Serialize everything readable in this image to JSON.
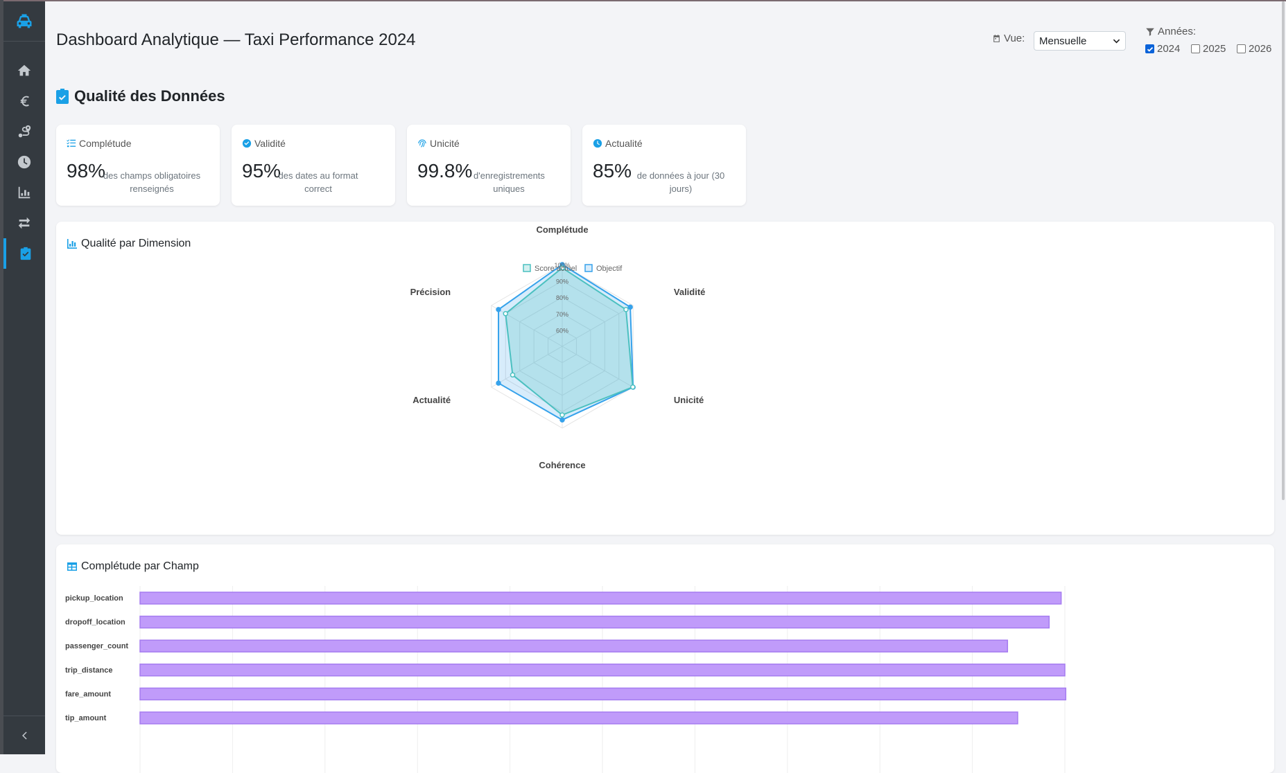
{
  "header": {
    "title": "Dashboard Analytique — Taxi Performance 2024",
    "view_label": "Vue:",
    "view_selected": "Mensuelle",
    "years_label": "Années:",
    "years": [
      {
        "label": "2024",
        "checked": true
      },
      {
        "label": "2025",
        "checked": false
      },
      {
        "label": "2026",
        "checked": false
      }
    ]
  },
  "sidebar": {
    "items": [
      {
        "icon": "taxi-icon",
        "label": ""
      },
      {
        "icon": "home-icon"
      },
      {
        "icon": "euro-icon"
      },
      {
        "icon": "route-icon"
      },
      {
        "icon": "clock-icon"
      },
      {
        "icon": "chart-icon"
      },
      {
        "icon": "exchange-icon"
      },
      {
        "icon": "clipboard-check-icon",
        "active": true
      }
    ],
    "collapse_icon": "chevron-left-icon"
  },
  "quality": {
    "title": "Qualité des Données",
    "kpis": [
      {
        "icon": "list-check-icon",
        "label": "Complétude",
        "value": "98%",
        "desc": "des champs obligatoires renseignés"
      },
      {
        "icon": "check-circle-icon",
        "label": "Validité",
        "value": "95%",
        "desc": "des dates au format correct"
      },
      {
        "icon": "fingerprint-icon",
        "label": "Unicité",
        "value": "99.8%",
        "desc": "d'enregistrements uniques"
      },
      {
        "icon": "clock-icon",
        "label": "Actualité",
        "value": "85%",
        "desc": "de données à jour (30 jours)"
      }
    ]
  },
  "radar_panel": {
    "title": "Qualité par Dimension"
  },
  "bars_panel": {
    "title": "Complétude par Champ"
  },
  "colors": {
    "accent": "#1aa0e6",
    "sidebar": "#343a40",
    "radar_actual": "#4bc0c0",
    "radar_target": "#36a2eb",
    "bar": "#c09bfa"
  },
  "chart_data": [
    {
      "type": "radar",
      "axes": [
        "Complétude",
        "Validité",
        "Unicité",
        "Cohérence",
        "Actualité",
        "Précision"
      ],
      "tick_labels": [
        "60%",
        "70%",
        "80%",
        "90%",
        "100%"
      ],
      "range": [
        50,
        100
      ],
      "legend": "top",
      "series": [
        {
          "name": "Score actuel",
          "values": [
            98,
            95,
            99.8,
            92,
            85,
            90
          ]
        },
        {
          "name": "Objectif",
          "values": [
            100,
            98,
            100,
            95,
            95,
            95
          ]
        }
      ]
    },
    {
      "type": "bar",
      "orientation": "horizontal",
      "categories": [
        "pickup_location",
        "dropoff_location",
        "passenger_count",
        "trip_distance",
        "fare_amount",
        "tip_amount"
      ],
      "values": [
        99.6,
        98.3,
        93.8,
        100,
        100.1,
        94.9
      ],
      "xlim": [
        0,
        100
      ]
    }
  ]
}
